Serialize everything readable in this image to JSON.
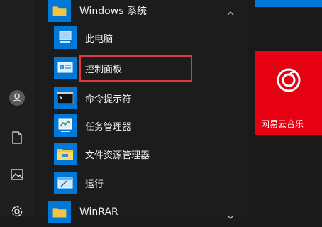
{
  "start_menu": {
    "groups": [
      {
        "label": "Windows 系统",
        "expanded": true
      },
      {
        "label": "WinRAR",
        "expanded": false
      }
    ],
    "items": [
      {
        "label": "此电脑",
        "icon": "computer-icon"
      },
      {
        "label": "控制面板",
        "icon": "control-panel-icon"
      },
      {
        "label": "命令提示符",
        "icon": "command-prompt-icon"
      },
      {
        "label": "任务管理器",
        "icon": "task-manager-icon"
      },
      {
        "label": "文件资源管理器",
        "icon": "file-explorer-icon"
      },
      {
        "label": "运行",
        "icon": "run-icon"
      }
    ],
    "highlighted_item": "控制面板"
  },
  "tiles": [
    {
      "label": "网易云音乐",
      "color": "#e60012",
      "icon": "netease-music-icon"
    }
  ],
  "left_rail": [
    "user-icon",
    "document-icon",
    "pictures-icon",
    "settings-icon"
  ],
  "colors": {
    "accent": "#0078d7",
    "highlight_border": "#e0383e",
    "tile_red": "#e60012"
  }
}
